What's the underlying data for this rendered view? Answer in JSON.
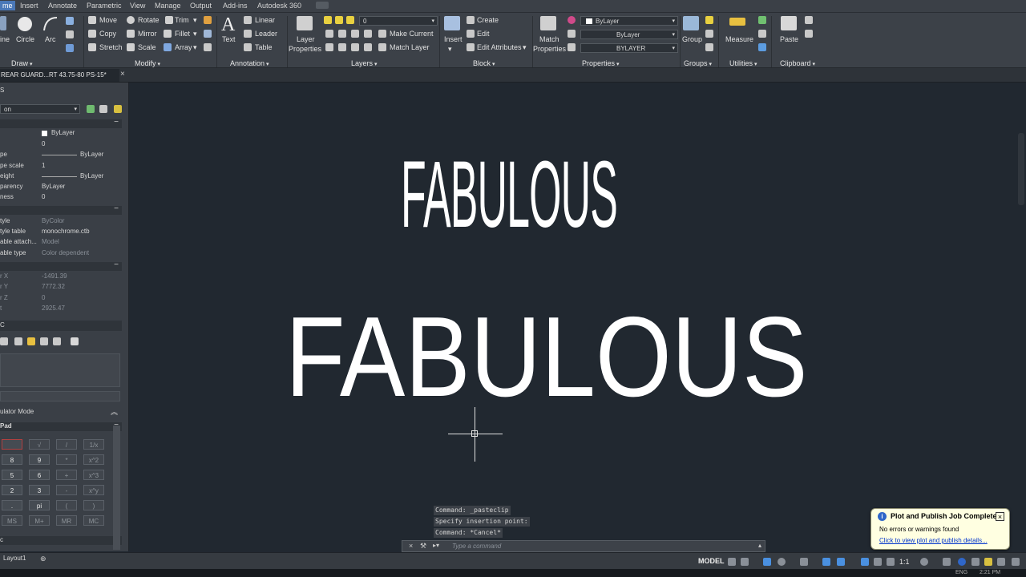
{
  "menu": {
    "tabs": [
      "me",
      "Insert",
      "Annotate",
      "Parametric",
      "View",
      "Manage",
      "Output",
      "Add-ins",
      "Autodesk 360"
    ]
  },
  "ribbon": {
    "draw": {
      "line": "ine",
      "circle": "Circle",
      "arc": "Arc",
      "title": "Draw"
    },
    "modify": {
      "move": "Move",
      "rotate": "Rotate",
      "trim": "Trim",
      "copy": "Copy",
      "mirror": "Mirror",
      "fillet": "Fillet",
      "stretch": "Stretch",
      "scale": "Scale",
      "array": "Array",
      "title": "Modify"
    },
    "annotation": {
      "text": "Text",
      "linear": "Linear",
      "leader": "Leader",
      "table": "Table",
      "title": "Annotation"
    },
    "layers": {
      "layer_props": "Layer",
      "layer_props2": "Properties",
      "layer_combo": "0",
      "make_current": "Make Current",
      "match_layer": "Match Layer",
      "title": "Layers"
    },
    "block": {
      "insert": "Insert",
      "create": "Create",
      "edit": "Edit",
      "edit_attributes": "Edit Attributes",
      "title": "Block"
    },
    "properties": {
      "match": "Match",
      "match2": "Properties",
      "color_combo": "ByLayer",
      "linetype_combo": "ByLayer",
      "lineweight_combo": "BYLAYER",
      "title": "Properties"
    },
    "groups": {
      "group": "Group",
      "title": "Groups"
    },
    "utilities": {
      "measure": "Measure",
      "title": "Utilities"
    },
    "clipboard": {
      "paste": "Paste",
      "title": "Clipboard"
    }
  },
  "doc_tab": {
    "name": "REAR GUARD...RT 43.75-80 PS-15*",
    "plus": "+"
  },
  "palette": {
    "title": "S",
    "selector": "on",
    "general": [
      {
        "k": "",
        "v": "ByLayer"
      },
      {
        "k": "",
        "v": "0"
      },
      {
        "k": "pe",
        "v": "ByLayer"
      },
      {
        "k": "pe scale",
        "v": "1"
      },
      {
        "k": "eight",
        "v": "ByLayer"
      },
      {
        "k": "parency",
        "v": "ByLayer"
      },
      {
        "k": "ness",
        "v": "0"
      }
    ],
    "plot": [
      {
        "k": "tyle",
        "v": "ByColor",
        "dim": true
      },
      {
        "k": "tyle table",
        "v": "monochrome.ctb",
        "dim": false
      },
      {
        "k": "able attach...",
        "v": "Model",
        "dim": true
      },
      {
        "k": "able type",
        "v": "Color dependent",
        "dim": true
      }
    ],
    "view": [
      {
        "k": "r X",
        "v": "-1491.39"
      },
      {
        "k": "r Y",
        "v": "7772.32"
      },
      {
        "k": "r Z",
        "v": "0"
      },
      {
        "k": "t",
        "v": "2925.47"
      }
    ],
    "misc_label": "C",
    "calc_mode": "ulator Mode",
    "pad_label": "Pad",
    "calc_rows": [
      [
        "",
        "√",
        "/",
        "1/x"
      ],
      [
        "8",
        "9",
        "*",
        "x^2"
      ],
      [
        "5",
        "6",
        "+",
        "x^3"
      ],
      [
        "2",
        "3",
        "-",
        "x^y"
      ],
      [
        ".",
        "pi",
        "(",
        ")"
      ],
      [
        "MS",
        "M+",
        "MR",
        "MC"
      ]
    ],
    "bottom_label": "c"
  },
  "drawing": {
    "text_narrow": "FABULOUS",
    "text_wide": "FABULOUS"
  },
  "command": {
    "history": [
      "Command: _pasteclip",
      "Specify insertion point:",
      "Command: *Cancel*"
    ],
    "placeholder": "Type a command"
  },
  "status": {
    "layout_tab": "Layout1",
    "model": "MODEL",
    "scale": "1:1",
    "lang": "ENG",
    "time": "2:21 PM"
  },
  "notification": {
    "title": "Plot and Publish Job Complete",
    "message": "No errors or warnings found",
    "link": "Click to view plot and publish details..."
  },
  "colors": {
    "accent": "#4a78b8",
    "canvas": "#212830",
    "panel": "#3a3f46"
  }
}
